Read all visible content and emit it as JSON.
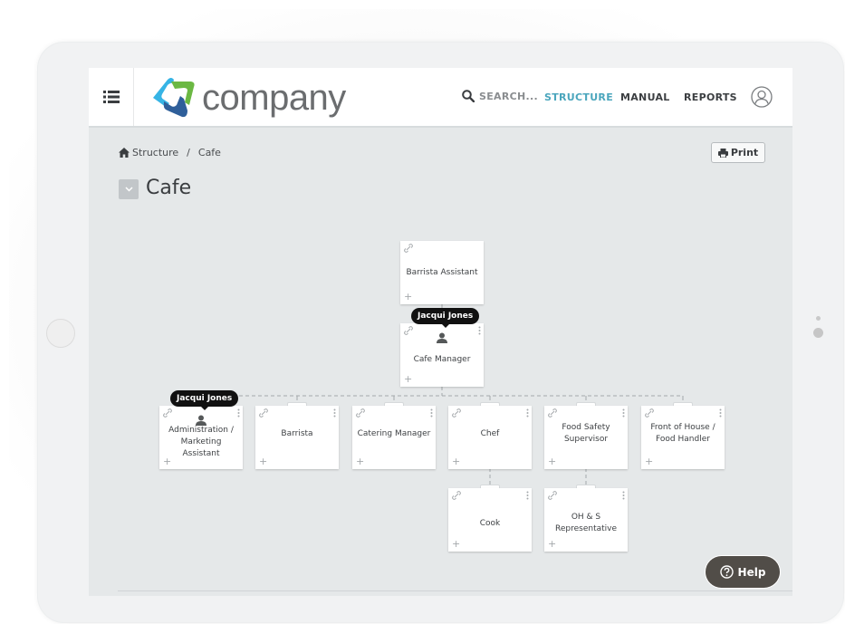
{
  "header": {
    "brand": "company",
    "search_placeholder": "SEARCH...",
    "nav": [
      {
        "label": "STRUCTURE",
        "active": true
      },
      {
        "label": "MANUAL",
        "active": false
      },
      {
        "label": "REPORTS",
        "active": false
      }
    ]
  },
  "breadcrumb": {
    "items": [
      "Structure",
      "Cafe"
    ],
    "separator": "/"
  },
  "toolbar": {
    "print_label": "Print"
  },
  "page": {
    "title": "Cafe"
  },
  "org_chart": {
    "nodes": [
      {
        "id": "barrista-assistant",
        "title": "Barrista Assistant",
        "parent": null
      },
      {
        "id": "cafe-manager",
        "title": "Cafe Manager",
        "parent": "barrista-assistant",
        "assignee": "Jacqui Jones"
      },
      {
        "id": "admin-marketing",
        "title": "Administration / Marketing Assistant",
        "parent": "cafe-manager",
        "assignee": "Jacqui Jones"
      },
      {
        "id": "barrista",
        "title": "Barrista",
        "parent": "cafe-manager"
      },
      {
        "id": "catering-manager",
        "title": "Catering Manager",
        "parent": "cafe-manager"
      },
      {
        "id": "chef",
        "title": "Chef",
        "parent": "cafe-manager"
      },
      {
        "id": "food-safety-supervisor",
        "title": "Food Safety Supervisor",
        "parent": "cafe-manager"
      },
      {
        "id": "front-of-house",
        "title": "Front of House / Food Handler",
        "parent": "cafe-manager"
      },
      {
        "id": "cook",
        "title": "Cook",
        "parent": "chef"
      },
      {
        "id": "ohs-rep",
        "title": "OH & S Representative",
        "parent": "food-safety-supervisor"
      }
    ]
  },
  "help": {
    "label": "Help"
  },
  "colors": {
    "accent": "#4ba6bd",
    "logo_blue_light": "#36b4e5",
    "logo_green": "#6bb843",
    "logo_blue_dark": "#2f5f9a",
    "help_bg": "#514d48",
    "canvas_bg": "#e5e8e9"
  }
}
